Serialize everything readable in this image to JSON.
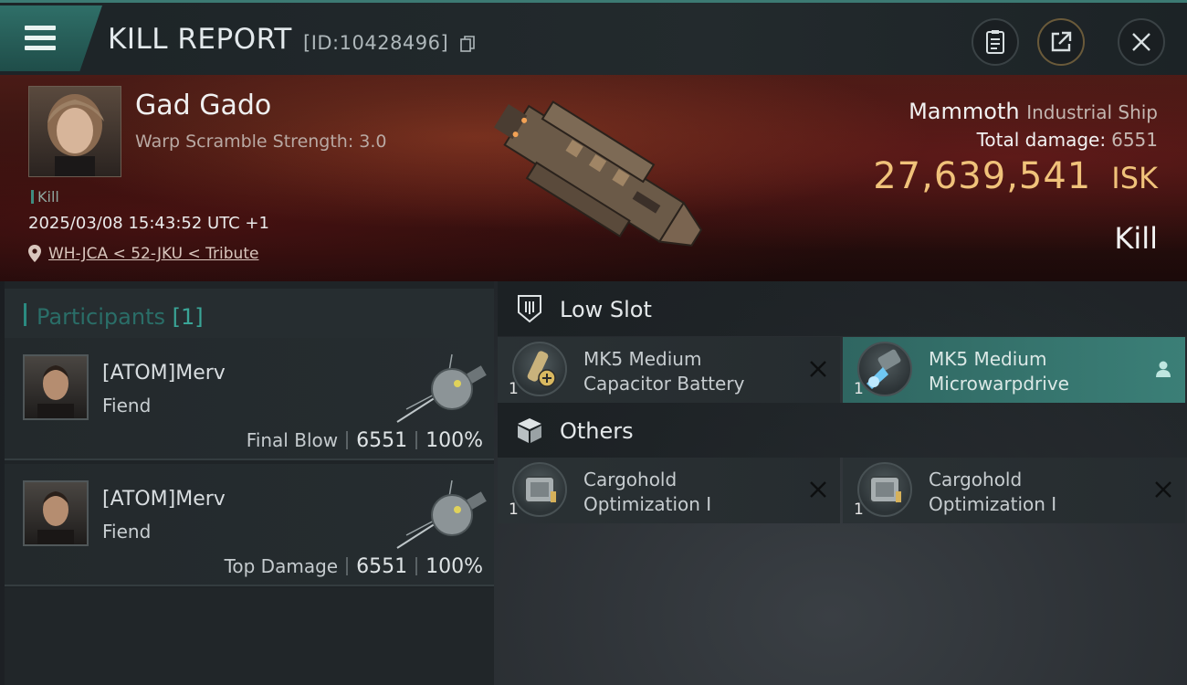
{
  "header": {
    "title": "KILL REPORT",
    "report_id": "[ID:10428496]"
  },
  "victim": {
    "name": "Gad Gado",
    "warp_scramble": "Warp Scramble Strength: 3.0",
    "kill_tag": "Kill",
    "datetime": "2025/03/08 15:43:52 UTC +1",
    "location": "WH-JCA < 52-JKU < Tribute",
    "ship_name": "Mammoth",
    "ship_class": "Industrial Ship",
    "total_damage_label": "Total damage:",
    "total_damage": "6551",
    "isk_value": "27,639,541",
    "isk_unit": "ISK",
    "result": "Kill"
  },
  "participants": {
    "label": "Participants",
    "count": "[1]",
    "items": [
      {
        "name": "[ATOM]Merv",
        "ship": "Fiend",
        "role": "Final Blow",
        "damage": "6551",
        "percent": "100%"
      },
      {
        "name": "[ATOM]Merv",
        "ship": "Fiend",
        "role": "Top Damage",
        "damage": "6551",
        "percent": "100%"
      }
    ]
  },
  "fittings": {
    "sections": [
      {
        "label": "Low Slot",
        "icon": "low-slot-icon",
        "items": [
          {
            "qty": "1",
            "line1": "MK5 Medium",
            "line2": "Capacitor Battery",
            "status": "destroyed"
          },
          {
            "qty": "1",
            "line1": "MK5 Medium",
            "line2": "Microwarpdrive",
            "status": "dropped"
          }
        ]
      },
      {
        "label": "Others",
        "icon": "cargo-box-icon",
        "items": [
          {
            "qty": "1",
            "line1": "Cargohold",
            "line2": "Optimization I",
            "status": "destroyed"
          },
          {
            "qty": "1",
            "line1": "Cargohold",
            "line2": "Optimization I",
            "status": "destroyed"
          }
        ]
      }
    ]
  },
  "colors": {
    "accent_teal": "#2b8a80",
    "isk_gold": "#f0c27a",
    "active_module": "#3b7f77"
  }
}
